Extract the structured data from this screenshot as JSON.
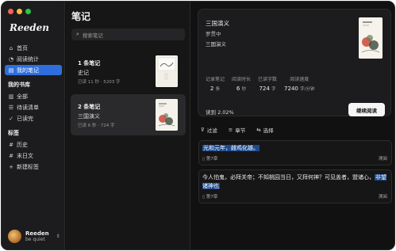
{
  "app": {
    "name": "Reeden"
  },
  "window": {
    "controls": {
      "close_color": "#ff5f57",
      "minimize_color": "#febc2e",
      "zoom_color": "#28c840"
    }
  },
  "sidebar": {
    "items": [
      {
        "label": "首页",
        "icon": "home-icon",
        "active": false
      },
      {
        "label": "阅读统计",
        "icon": "stats-icon",
        "active": false
      },
      {
        "label": "我的笔记",
        "icon": "notes-icon",
        "active": true
      }
    ],
    "library_title": "我的书库",
    "library_items": [
      {
        "label": "全部",
        "icon": "books-icon"
      },
      {
        "label": "待读清单",
        "icon": "list-icon"
      },
      {
        "label": "已读完",
        "icon": "check-circle-icon"
      }
    ],
    "tags_title": "标签",
    "tag_items": [
      {
        "label": "历史",
        "icon": "hash-icon"
      },
      {
        "label": "末日文",
        "icon": "hash-icon"
      },
      {
        "label": "新建标签",
        "icon": "plus-icon"
      }
    ],
    "user": {
      "name": "Reeden",
      "status": "be quiet"
    }
  },
  "middle": {
    "title": "笔记",
    "search_placeholder": "搜索笔记",
    "cards": [
      {
        "count": "1 条笔记",
        "title": "史记",
        "meta": "已读 11 秒 · 5203 字",
        "selected": false
      },
      {
        "count": "2 条笔记",
        "title": "三国演义",
        "meta": "已读 6 秒 · 724 字",
        "selected": true
      }
    ]
  },
  "detail": {
    "title": "三国演义",
    "author": "罗贯中",
    "subtitle": "三国演义",
    "stats": [
      {
        "label": "记录笔记",
        "value": "2",
        "unit": "条"
      },
      {
        "label": "阅读时长",
        "value": "6",
        "unit": "秒"
      },
      {
        "label": "已读字数",
        "value": "724",
        "unit": "字"
      },
      {
        "label": "阅读速度",
        "value": "7240",
        "unit": "字/分钟"
      }
    ],
    "progress_text": "读到 2.02%",
    "continue_label": "继续阅读",
    "filters": {
      "filter": "过滤",
      "chapter": "章节",
      "select": "选择"
    },
    "notes": [
      {
        "highlight": "光和元年，雌鸡化雄。",
        "rest": "",
        "chapter": "第7章",
        "action": "溯阅"
      },
      {
        "highlight": "非望诸神也",
        "lead": "今人怕鬼，必拜关帝；不知桃园当日，又拜何神？可见盖者，盟诸心，",
        "chapter": "第7章",
        "action": "溯阅"
      }
    ]
  }
}
